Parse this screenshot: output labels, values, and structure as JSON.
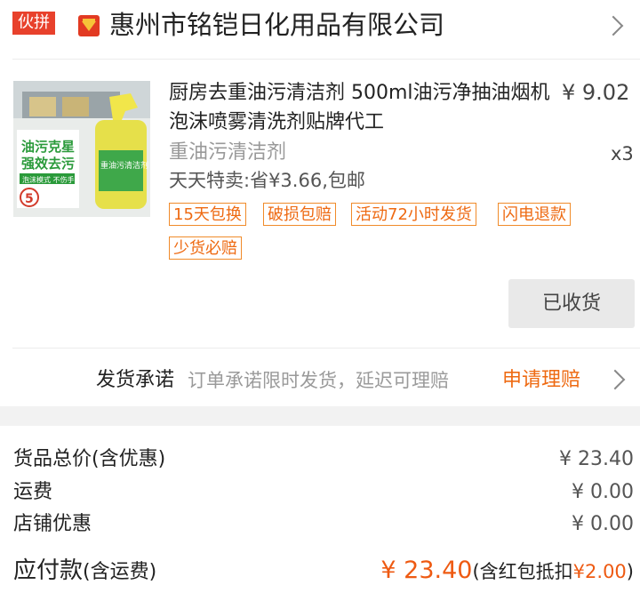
{
  "shop": {
    "badge": "伙拼",
    "name": "惠州市铭铠日化用品有限公司"
  },
  "product": {
    "title": "厨房去重油污清洁剂 500ml油污净抽油烟机泡沫喷雾清洗剂贴牌代工",
    "price": "¥ 9.02",
    "sku": "重油污清洁剂",
    "quantity": "x3",
    "promo": "天天特卖:省¥3.66,包邮",
    "tags": [
      "15天包换",
      "破损包赔",
      "活动72小时发货",
      "闪电退款",
      "少货必赔"
    ],
    "image_text": {
      "line1": "油污克星",
      "line2": "强效去污",
      "line3": "泡沫模式 不伤手",
      "badge": "5",
      "bottle": "重油污清洁剂"
    }
  },
  "actions": {
    "received": "已收货"
  },
  "delivery_promise": {
    "label": "发货承诺",
    "text": "订单承诺限时发货，延迟可理赔",
    "claim": "申请理赔"
  },
  "summary": {
    "goods_total_label": "货品总价(含优惠)",
    "goods_total_value": "¥ 23.40",
    "shipping_label": "运费",
    "shipping_value": "¥ 0.00",
    "shop_discount_label": "店铺优惠",
    "shop_discount_value": "¥ 0.00",
    "payable_label": "应付款",
    "payable_sub": "(含运费)",
    "payable_value": "¥ 23.40",
    "payable_note_prefix": "(含红包抵扣",
    "payable_note_amount": "¥2.00",
    "payable_note_suffix": ")"
  },
  "colors": {
    "accent_orange": "#ee6a12",
    "badge_red": "#e8412c",
    "button_gray": "#e9e9e9"
  }
}
